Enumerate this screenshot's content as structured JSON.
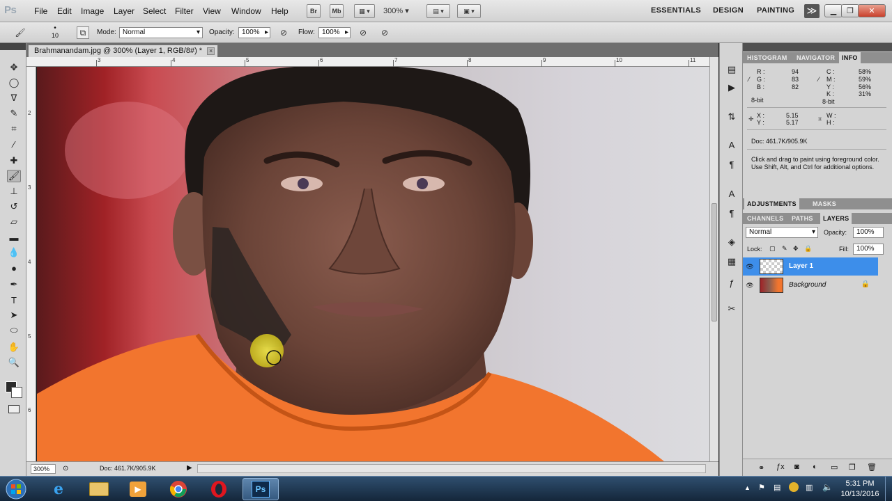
{
  "app": {
    "logo": "Ps"
  },
  "menubar": {
    "items": [
      "File",
      "Edit",
      "Image",
      "Layer",
      "Select",
      "Filter",
      "View",
      "Window",
      "Help"
    ],
    "bridge_label": "Br",
    "minibridge_label": "Mb",
    "zoom": "300%",
    "workspaces": [
      "ESSENTIALS",
      "DESIGN",
      "PAINTING"
    ],
    "more_glyph": "≫"
  },
  "options": {
    "brush_size": "10",
    "mode_label": "Mode:",
    "mode_value": "Normal",
    "opacity_label": "Opacity:",
    "opacity_value": "100%",
    "flow_label": "Flow:",
    "flow_value": "100%"
  },
  "document": {
    "tab_title": "Brahmanandam.jpg @ 300% (Layer 1, RGB/8#) *",
    "close_glyph": "×",
    "ruler_top": [
      "3",
      "4",
      "5",
      "6",
      "7",
      "8",
      "9",
      "10",
      "11"
    ],
    "ruler_left": [
      "2",
      "3",
      "4",
      "5",
      "6"
    ],
    "status_zoom": "300%",
    "status_doc": "Doc: 461.7K/905.9K"
  },
  "panels": {
    "top_tabs": [
      "HISTOGRAM",
      "NAVIGATOR",
      "INFO"
    ],
    "info": {
      "r_label": "R :",
      "r_value": "94",
      "g_label": "G :",
      "g_value": "83",
      "b_label": "B :",
      "b_value": "82",
      "bit_left": "8-bit",
      "c_label": "C :",
      "c_value": "58%",
      "m_label": "M :",
      "m_value": "59%",
      "y_label": "Y :",
      "y_value": "56%",
      "k_label": "K :",
      "k_value": "31%",
      "bit_right": "8-bit",
      "x_label": "X :",
      "x_value": "5.15",
      "yy_label": "Y :",
      "yy_value": "5.17",
      "w_label": "W :",
      "h_label": "H :",
      "doc": "Doc: 461.7K/905.9K",
      "hint": "Click and drag to paint using foreground color.  Use Shift, Alt, and Ctrl for additional options."
    },
    "mid_tabs": [
      "ADJUSTMENTS",
      "MASKS"
    ],
    "layer_tabs": [
      "CHANNELS",
      "PATHS",
      "LAYERS"
    ],
    "layers": {
      "blend_mode": "Normal",
      "opacity_label": "Opacity:",
      "opacity_value": "100%",
      "lock_label": "Lock:",
      "fill_label": "Fill:",
      "fill_value": "100%",
      "items": [
        {
          "name": "Layer 1",
          "selected": true
        },
        {
          "name": "Background",
          "selected": false
        }
      ]
    }
  },
  "taskbar": {
    "time": "5:31 PM",
    "date": "10/13/2016"
  },
  "colors": {
    "selection_blue": "#3d8eea",
    "menubar": "#dcdcdc",
    "shirt_orange": "#f2752e",
    "brush_highlight": "#e0d21e"
  }
}
